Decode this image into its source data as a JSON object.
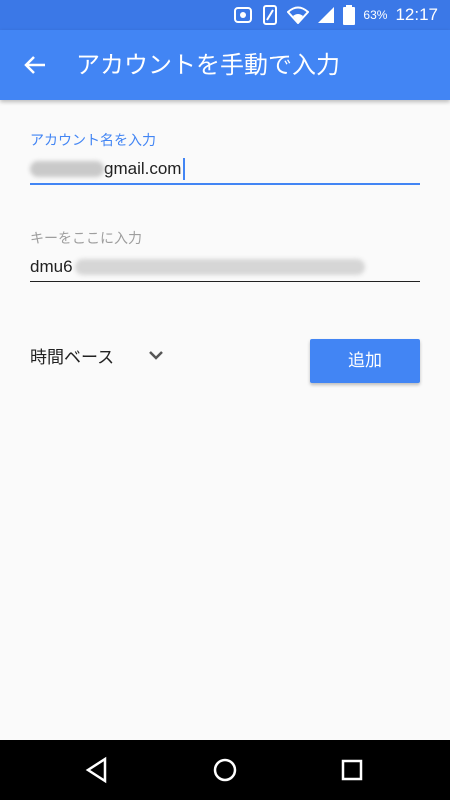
{
  "status_bar": {
    "battery_percent": "63%",
    "time": "12:17",
    "icons": [
      "notification-icon",
      "vibrate-icon",
      "wifi-icon",
      "signal-icon",
      "battery-icon"
    ]
  },
  "app_bar": {
    "title": "アカウントを手動で入力",
    "back_icon": "arrow-back-icon"
  },
  "form": {
    "account_label": "アカウント名を入力",
    "account_value_visible": "gmail.com",
    "key_label": "キーをここに入力",
    "key_value_visible": "dmu6",
    "type_select": "時間ベース",
    "add_button": "追加"
  },
  "colors": {
    "primary": "#4285f4",
    "primary_dark": "#3b78e7",
    "background": "#fafafa"
  }
}
